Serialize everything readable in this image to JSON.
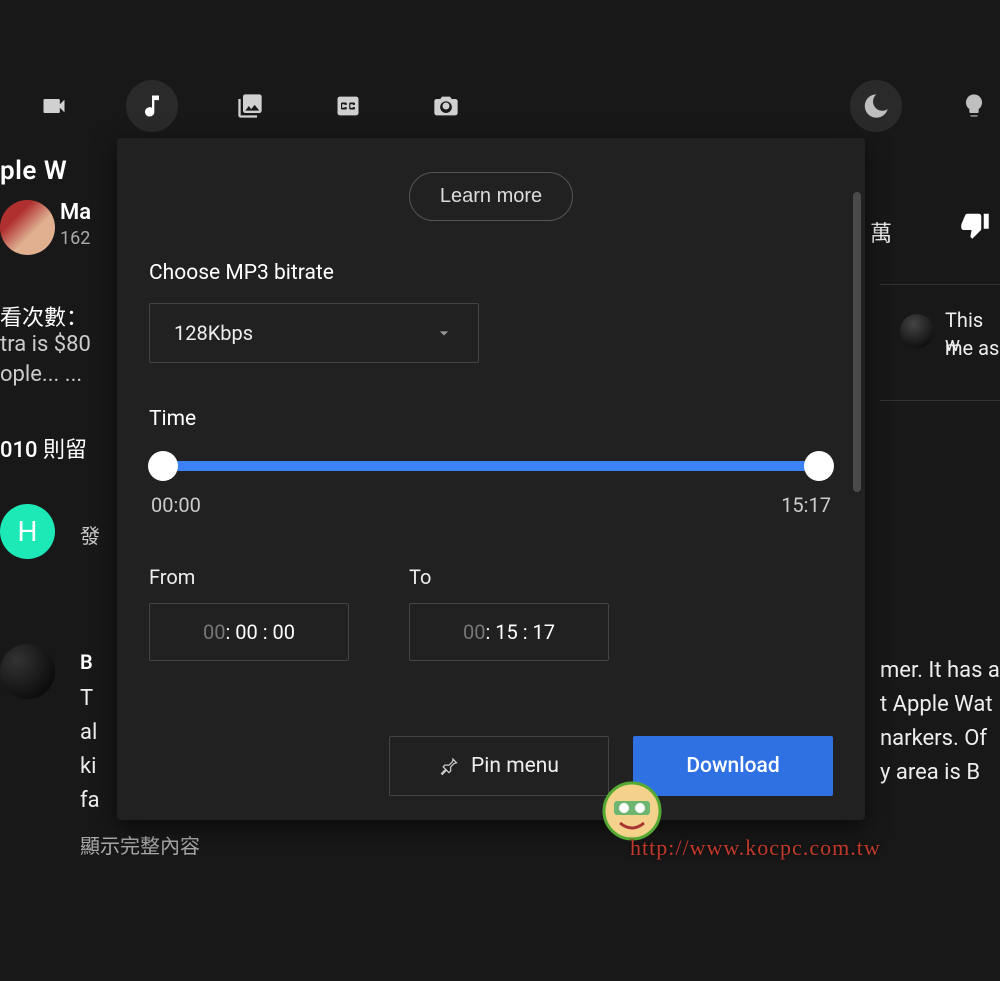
{
  "toolbar": {
    "tabs": [
      "video",
      "audio",
      "image",
      "cc",
      "camera"
    ],
    "active": "audio",
    "right": [
      "moon",
      "bulb"
    ]
  },
  "background": {
    "title_fragment": "ple W",
    "channel": {
      "name_fragment": "Ma",
      "subs_fragment": "162"
    },
    "views_label_fragment": "看次數：",
    "desc_line1_fragment": "tra is $80",
    "desc_line2_fragment": "ople... ...",
    "comments_count_fragment": "010 則留",
    "avatar_h_letter": "H",
    "h_text_fragment": "發",
    "comment_b": {
      "name_fragment": "B",
      "l1": "T",
      "l2": "al",
      "l3": "ki",
      "l4": "fa"
    },
    "show_more": "顯示完整內容",
    "right": {
      "like_count_fragment": "萬",
      "comment_line1": "This w",
      "comment_line2": "me as",
      "body_l1": "mer. It has a",
      "body_l2": "t Apple Wat",
      "body_l3": "narkers. Of",
      "body_l4": "y area is B"
    }
  },
  "panel": {
    "learn_more": "Learn more",
    "bitrate_label": "Choose MP3 bitrate",
    "bitrate_value": "128Kbps",
    "time_label": "Time",
    "time_start": "00:00",
    "time_end": "15:17",
    "from_label": "From",
    "to_label": "To",
    "from_value_dim": "00",
    "from_value_rest": " : 00 : 00",
    "to_value_dim": "00",
    "to_value_rest": " : 15 : 17",
    "pin_label": "Pin menu",
    "download_label": "Download"
  },
  "watermark": {
    "url": "http://www.kocpc.com.tw"
  }
}
